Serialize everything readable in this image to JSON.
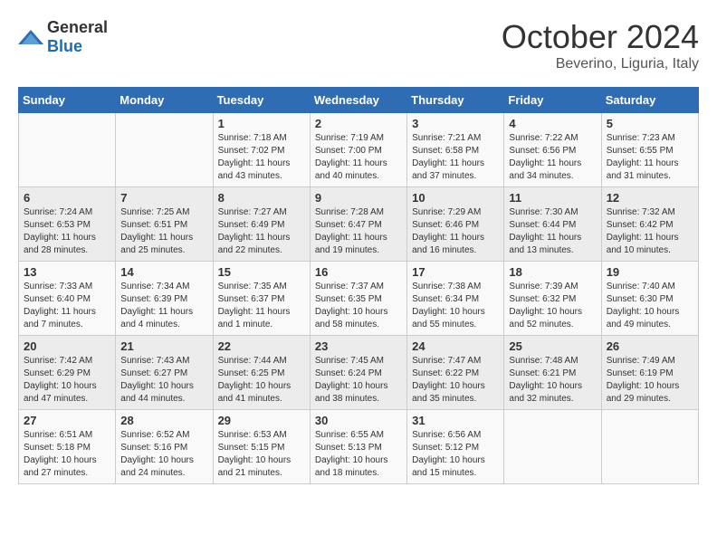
{
  "logo": {
    "general": "General",
    "blue": "Blue"
  },
  "header": {
    "month": "October 2024",
    "location": "Beverino, Liguria, Italy"
  },
  "weekdays": [
    "Sunday",
    "Monday",
    "Tuesday",
    "Wednesday",
    "Thursday",
    "Friday",
    "Saturday"
  ],
  "weeks": [
    [
      {
        "day": "",
        "sunrise": "",
        "sunset": "",
        "daylight": ""
      },
      {
        "day": "",
        "sunrise": "",
        "sunset": "",
        "daylight": ""
      },
      {
        "day": "1",
        "sunrise": "Sunrise: 7:18 AM",
        "sunset": "Sunset: 7:02 PM",
        "daylight": "Daylight: 11 hours and 43 minutes."
      },
      {
        "day": "2",
        "sunrise": "Sunrise: 7:19 AM",
        "sunset": "Sunset: 7:00 PM",
        "daylight": "Daylight: 11 hours and 40 minutes."
      },
      {
        "day": "3",
        "sunrise": "Sunrise: 7:21 AM",
        "sunset": "Sunset: 6:58 PM",
        "daylight": "Daylight: 11 hours and 37 minutes."
      },
      {
        "day": "4",
        "sunrise": "Sunrise: 7:22 AM",
        "sunset": "Sunset: 6:56 PM",
        "daylight": "Daylight: 11 hours and 34 minutes."
      },
      {
        "day": "5",
        "sunrise": "Sunrise: 7:23 AM",
        "sunset": "Sunset: 6:55 PM",
        "daylight": "Daylight: 11 hours and 31 minutes."
      }
    ],
    [
      {
        "day": "6",
        "sunrise": "Sunrise: 7:24 AM",
        "sunset": "Sunset: 6:53 PM",
        "daylight": "Daylight: 11 hours and 28 minutes."
      },
      {
        "day": "7",
        "sunrise": "Sunrise: 7:25 AM",
        "sunset": "Sunset: 6:51 PM",
        "daylight": "Daylight: 11 hours and 25 minutes."
      },
      {
        "day": "8",
        "sunrise": "Sunrise: 7:27 AM",
        "sunset": "Sunset: 6:49 PM",
        "daylight": "Daylight: 11 hours and 22 minutes."
      },
      {
        "day": "9",
        "sunrise": "Sunrise: 7:28 AM",
        "sunset": "Sunset: 6:47 PM",
        "daylight": "Daylight: 11 hours and 19 minutes."
      },
      {
        "day": "10",
        "sunrise": "Sunrise: 7:29 AM",
        "sunset": "Sunset: 6:46 PM",
        "daylight": "Daylight: 11 hours and 16 minutes."
      },
      {
        "day": "11",
        "sunrise": "Sunrise: 7:30 AM",
        "sunset": "Sunset: 6:44 PM",
        "daylight": "Daylight: 11 hours and 13 minutes."
      },
      {
        "day": "12",
        "sunrise": "Sunrise: 7:32 AM",
        "sunset": "Sunset: 6:42 PM",
        "daylight": "Daylight: 11 hours and 10 minutes."
      }
    ],
    [
      {
        "day": "13",
        "sunrise": "Sunrise: 7:33 AM",
        "sunset": "Sunset: 6:40 PM",
        "daylight": "Daylight: 11 hours and 7 minutes."
      },
      {
        "day": "14",
        "sunrise": "Sunrise: 7:34 AM",
        "sunset": "Sunset: 6:39 PM",
        "daylight": "Daylight: 11 hours and 4 minutes."
      },
      {
        "day": "15",
        "sunrise": "Sunrise: 7:35 AM",
        "sunset": "Sunset: 6:37 PM",
        "daylight": "Daylight: 11 hours and 1 minute."
      },
      {
        "day": "16",
        "sunrise": "Sunrise: 7:37 AM",
        "sunset": "Sunset: 6:35 PM",
        "daylight": "Daylight: 10 hours and 58 minutes."
      },
      {
        "day": "17",
        "sunrise": "Sunrise: 7:38 AM",
        "sunset": "Sunset: 6:34 PM",
        "daylight": "Daylight: 10 hours and 55 minutes."
      },
      {
        "day": "18",
        "sunrise": "Sunrise: 7:39 AM",
        "sunset": "Sunset: 6:32 PM",
        "daylight": "Daylight: 10 hours and 52 minutes."
      },
      {
        "day": "19",
        "sunrise": "Sunrise: 7:40 AM",
        "sunset": "Sunset: 6:30 PM",
        "daylight": "Daylight: 10 hours and 49 minutes."
      }
    ],
    [
      {
        "day": "20",
        "sunrise": "Sunrise: 7:42 AM",
        "sunset": "Sunset: 6:29 PM",
        "daylight": "Daylight: 10 hours and 47 minutes."
      },
      {
        "day": "21",
        "sunrise": "Sunrise: 7:43 AM",
        "sunset": "Sunset: 6:27 PM",
        "daylight": "Daylight: 10 hours and 44 minutes."
      },
      {
        "day": "22",
        "sunrise": "Sunrise: 7:44 AM",
        "sunset": "Sunset: 6:25 PM",
        "daylight": "Daylight: 10 hours and 41 minutes."
      },
      {
        "day": "23",
        "sunrise": "Sunrise: 7:45 AM",
        "sunset": "Sunset: 6:24 PM",
        "daylight": "Daylight: 10 hours and 38 minutes."
      },
      {
        "day": "24",
        "sunrise": "Sunrise: 7:47 AM",
        "sunset": "Sunset: 6:22 PM",
        "daylight": "Daylight: 10 hours and 35 minutes."
      },
      {
        "day": "25",
        "sunrise": "Sunrise: 7:48 AM",
        "sunset": "Sunset: 6:21 PM",
        "daylight": "Daylight: 10 hours and 32 minutes."
      },
      {
        "day": "26",
        "sunrise": "Sunrise: 7:49 AM",
        "sunset": "Sunset: 6:19 PM",
        "daylight": "Daylight: 10 hours and 29 minutes."
      }
    ],
    [
      {
        "day": "27",
        "sunrise": "Sunrise: 6:51 AM",
        "sunset": "Sunset: 5:18 PM",
        "daylight": "Daylight: 10 hours and 27 minutes."
      },
      {
        "day": "28",
        "sunrise": "Sunrise: 6:52 AM",
        "sunset": "Sunset: 5:16 PM",
        "daylight": "Daylight: 10 hours and 24 minutes."
      },
      {
        "day": "29",
        "sunrise": "Sunrise: 6:53 AM",
        "sunset": "Sunset: 5:15 PM",
        "daylight": "Daylight: 10 hours and 21 minutes."
      },
      {
        "day": "30",
        "sunrise": "Sunrise: 6:55 AM",
        "sunset": "Sunset: 5:13 PM",
        "daylight": "Daylight: 10 hours and 18 minutes."
      },
      {
        "day": "31",
        "sunrise": "Sunrise: 6:56 AM",
        "sunset": "Sunset: 5:12 PM",
        "daylight": "Daylight: 10 hours and 15 minutes."
      },
      {
        "day": "",
        "sunrise": "",
        "sunset": "",
        "daylight": ""
      },
      {
        "day": "",
        "sunrise": "",
        "sunset": "",
        "daylight": ""
      }
    ]
  ]
}
